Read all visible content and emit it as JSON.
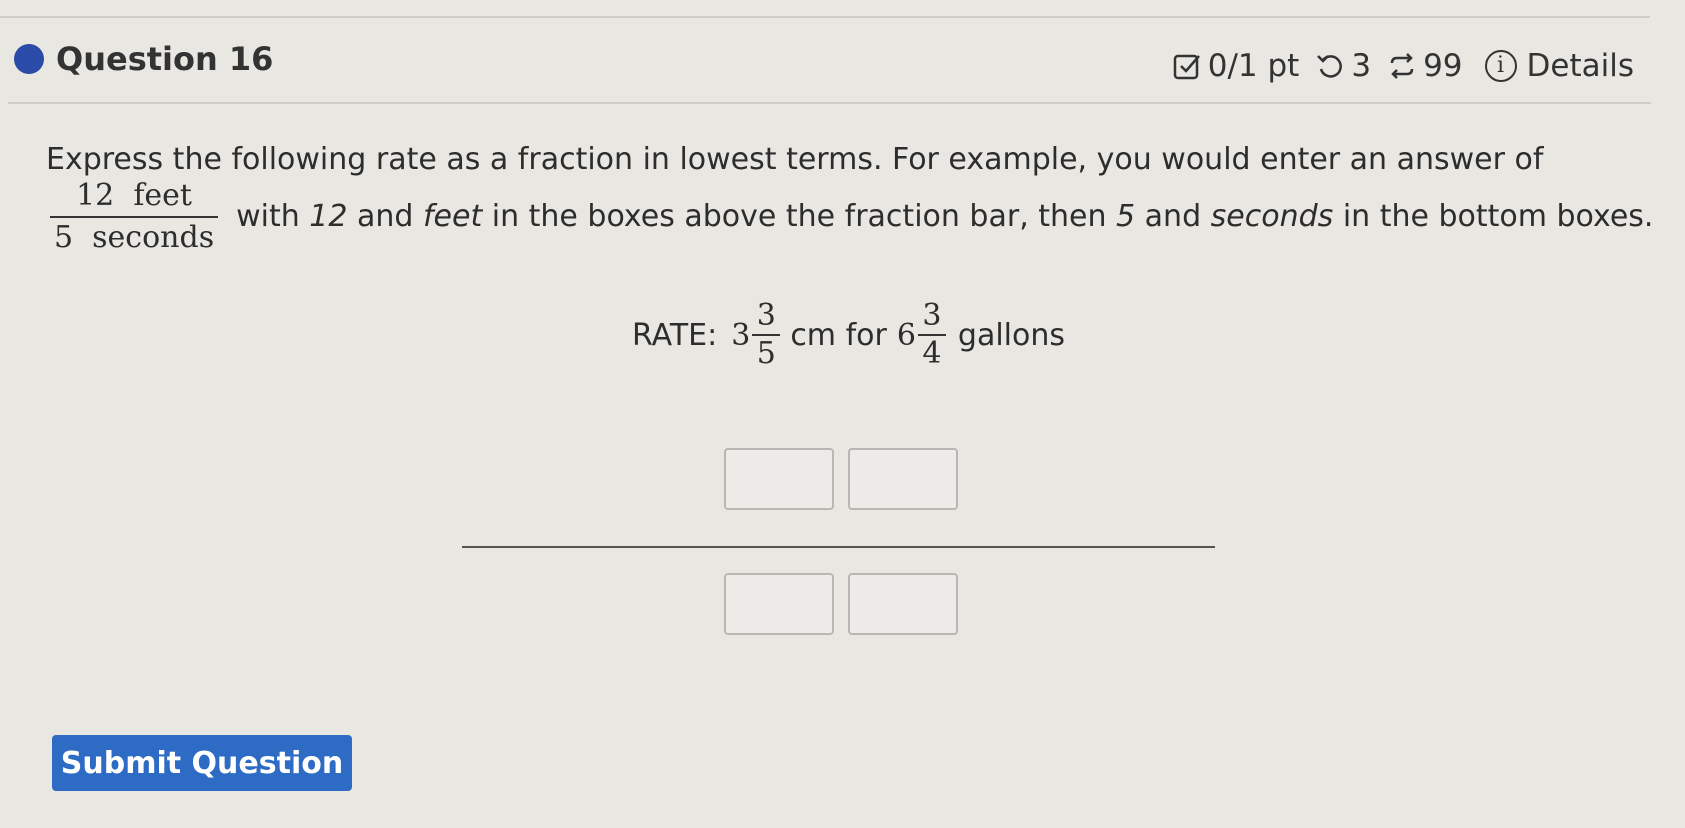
{
  "question": {
    "title": "Question 16",
    "score": "0/1 pt",
    "retries": "3",
    "attempts": "99",
    "details_label": "Details",
    "accent_color": "#2a4ba8"
  },
  "prompt": {
    "line1": "Express the following rate as a fraction in lowest terms. For example, you would enter an answer of",
    "example_numerator": "12  feet",
    "example_denominator": "5  seconds",
    "line2_a": "with ",
    "line2_num": "12",
    "line2_b": " and ",
    "line2_unit": "feet",
    "line2_c": " in the boxes above the fraction bar, then ",
    "line2_den": "5",
    "line2_d": " and ",
    "line2_denunit": "seconds",
    "line2_e": " in the bottom boxes."
  },
  "rate": {
    "label": "RATE:",
    "first_whole": "3",
    "first_num": "3",
    "first_den": "5",
    "first_unit": "cm for",
    "second_whole": "6",
    "second_num": "3",
    "second_den": "4",
    "second_unit": "gallons"
  },
  "answer": {
    "numerator_value": "",
    "numerator_unit": "",
    "denominator_value": "",
    "denominator_unit": ""
  },
  "submit": {
    "label": "Submit Question",
    "color": "#2d6bc4"
  }
}
